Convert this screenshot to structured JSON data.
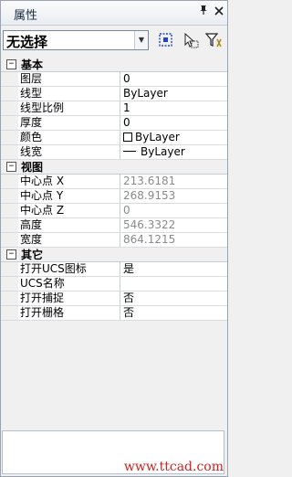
{
  "title": "属性",
  "title_buttons": {
    "pin_icon": "pin-icon",
    "close_icon": "close-icon"
  },
  "selection": {
    "value": "无选择"
  },
  "toolbar_icons": [
    "select-objects-icon",
    "pickadd-toggle-icon",
    "quick-select-filter-icon"
  ],
  "categories": [
    {
      "label": "基本",
      "expanded": true,
      "props": [
        {
          "name": "图层",
          "value": "0"
        },
        {
          "name": "线型",
          "value": "ByLayer"
        },
        {
          "name": "线型比例",
          "value": "1"
        },
        {
          "name": "厚度",
          "value": "0"
        },
        {
          "name": "颜色",
          "value": "ByLayer",
          "icon": "color-swatch"
        },
        {
          "name": "线宽",
          "value": "ByLayer",
          "icon": "lineweight-line"
        }
      ]
    },
    {
      "label": "视图",
      "expanded": true,
      "props": [
        {
          "name": "中心点 X",
          "value": "213.6181",
          "readonly": true
        },
        {
          "name": "中心点 Y",
          "value": "268.9153",
          "readonly": true
        },
        {
          "name": "中心点 Z",
          "value": "0",
          "readonly": true
        },
        {
          "name": "高度",
          "value": "546.3322",
          "readonly": true
        },
        {
          "name": "宽度",
          "value": "864.1215",
          "readonly": true
        }
      ]
    },
    {
      "label": "其它",
      "expanded": true,
      "props": [
        {
          "name": "打开UCS图标",
          "value": "是"
        },
        {
          "name": "UCS名称",
          "value": ""
        },
        {
          "name": "打开捕捉",
          "value": "否"
        },
        {
          "name": "打开栅格",
          "value": "否"
        }
      ]
    }
  ],
  "watermark": "www.ttcad.com"
}
